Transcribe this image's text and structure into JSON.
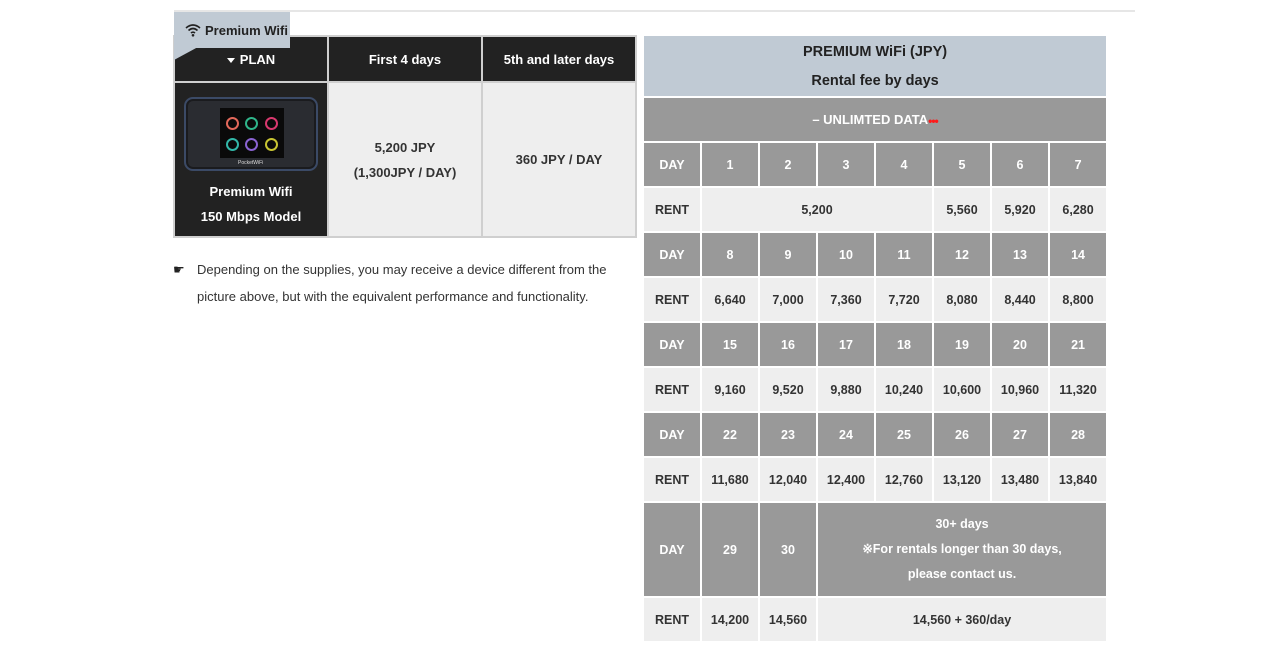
{
  "tab": {
    "label": "Premium Wifi",
    "icon": "wifi-icon"
  },
  "plan_table": {
    "headers": [
      "PLAN",
      "First 4 days",
      "5th and later days"
    ],
    "model": {
      "name": "Premium Wifi",
      "spec": "150 Mbps Model",
      "device_brand": "PocketWiFi"
    },
    "first_days": {
      "price": "5,200 JPY",
      "per_day": "(1,300JPY / DAY)"
    },
    "later_days": {
      "price": "360 JPY / DAY"
    }
  },
  "note": {
    "icon": "pointing-hand-icon",
    "text": "Depending on the supplies, you may receive a device different from the picture above, but with the equivalent performance and functionality."
  },
  "price_table": {
    "title": "PREMIUM WiFi (JPY)",
    "subtitle": "Rental fee by days",
    "unlimited": "– UNLIMTED DATA",
    "unlimited_dots": "•••",
    "day_label": "DAY",
    "rent_label": "RENT",
    "weeks": [
      {
        "days": [
          "1",
          "2",
          "3",
          "4",
          "5",
          "6",
          "7"
        ],
        "rent_merged": "5,200",
        "rents": [
          "5,560",
          "5,920",
          "6,280"
        ]
      },
      {
        "days": [
          "8",
          "9",
          "10",
          "11",
          "12",
          "13",
          "14"
        ],
        "rents": [
          "6,640",
          "7,000",
          "7,360",
          "7,720",
          "8,080",
          "8,440",
          "8,800"
        ]
      },
      {
        "days": [
          "15",
          "16",
          "17",
          "18",
          "19",
          "20",
          "21"
        ],
        "rents": [
          "9,160",
          "9,520",
          "9,880",
          "10,240",
          "10,600",
          "10,960",
          "11,320"
        ]
      },
      {
        "days": [
          "22",
          "23",
          "24",
          "25",
          "26",
          "27",
          "28"
        ],
        "rents": [
          "11,680",
          "12,040",
          "12,400",
          "12,760",
          "13,120",
          "13,480",
          "13,840"
        ]
      }
    ],
    "last": {
      "days": [
        "29",
        "30"
      ],
      "rents": [
        "14,200",
        "14,560"
      ],
      "extended_title": "30+ days",
      "extended_note_1": "※For rentals longer than 30 days,",
      "extended_note_2": "please contact us.",
      "extended_rent": "14,560 + 360/day"
    }
  },
  "colors": {
    "header_dark": "#222222",
    "tab_bg": "#c0cad4",
    "cell_gray": "#999999",
    "cell_light": "#eeeeee",
    "dots_red": "#ff1a1a"
  }
}
